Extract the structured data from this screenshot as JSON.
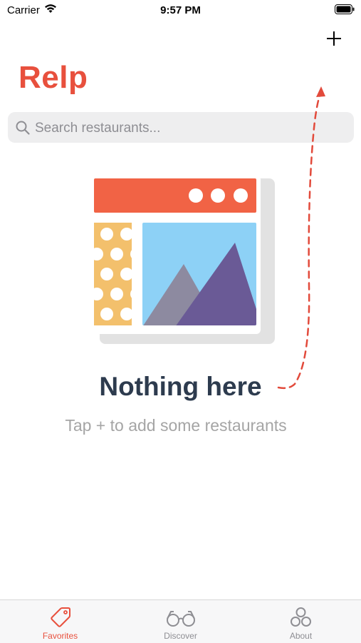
{
  "status_bar": {
    "carrier": "Carrier",
    "time": "9:57 PM"
  },
  "header": {
    "title": "Relp",
    "add_icon": "plus-icon"
  },
  "search": {
    "placeholder": "Search restaurants...",
    "value": ""
  },
  "empty_state": {
    "title": "Nothing here",
    "subtitle": "Tap +  to add some restaurants"
  },
  "tabs": [
    {
      "label": "Favorites",
      "icon": "tag-icon",
      "active": true
    },
    {
      "label": "Discover",
      "icon": "glasses-icon",
      "active": false
    },
    {
      "label": "About",
      "icon": "circles-icon",
      "active": false
    }
  ],
  "colors": {
    "accent": "#e8503d",
    "empty_title": "#2d3b4e",
    "subtitle": "#a5a5a5",
    "search_bg": "#eeeeef"
  }
}
